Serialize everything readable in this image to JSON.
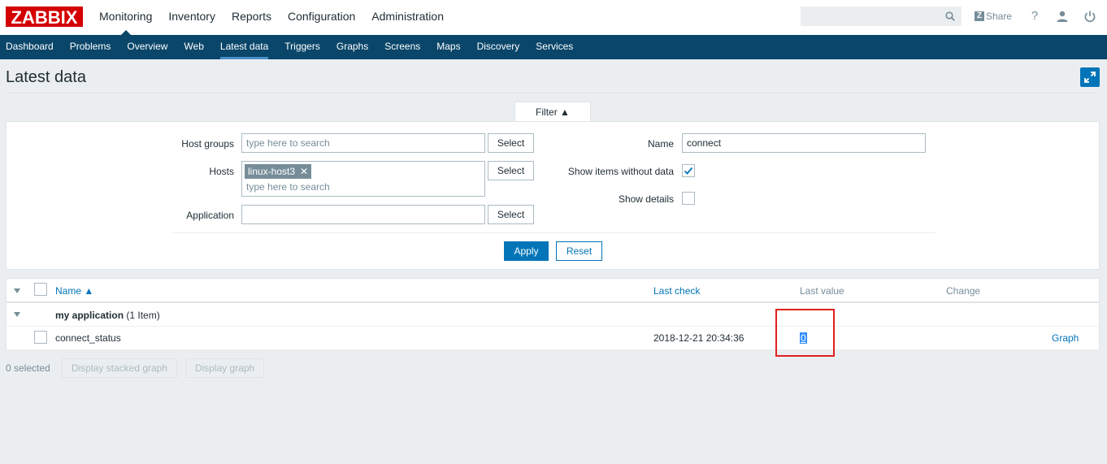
{
  "brand": {
    "logo_text": "ZABBIX",
    "color": "#d40000"
  },
  "colors": {
    "nav_bg": "#0a466a",
    "accent": "#0275b8",
    "highlight": "#e02020"
  },
  "main_nav": [
    {
      "label": "Monitoring",
      "active": true
    },
    {
      "label": "Inventory"
    },
    {
      "label": "Reports"
    },
    {
      "label": "Configuration"
    },
    {
      "label": "Administration"
    }
  ],
  "header": {
    "search_placeholder": "",
    "share_label": "Share",
    "share_icon_letter": "Z",
    "help_label": "?"
  },
  "sub_nav": [
    {
      "label": "Dashboard"
    },
    {
      "label": "Problems"
    },
    {
      "label": "Overview"
    },
    {
      "label": "Web"
    },
    {
      "label": "Latest data",
      "active": true
    },
    {
      "label": "Triggers"
    },
    {
      "label": "Graphs"
    },
    {
      "label": "Screens"
    },
    {
      "label": "Maps"
    },
    {
      "label": "Discovery"
    },
    {
      "label": "Services"
    }
  ],
  "page": {
    "title": "Latest data"
  },
  "filter": {
    "tab_label": "Filter ▲",
    "host_groups_label": "Host groups",
    "host_groups_placeholder": "type here to search",
    "hosts_label": "Hosts",
    "hosts_tag": "linux-host3",
    "hosts_placeholder": "type here to search",
    "application_label": "Application",
    "application_value": "",
    "select_label": "Select",
    "name_label": "Name",
    "name_value": "connect",
    "show_items_label": "Show items without data",
    "show_items_checked": true,
    "show_details_label": "Show details",
    "show_details_checked": false,
    "apply_label": "Apply",
    "reset_label": "Reset"
  },
  "table": {
    "columns": {
      "name": "Name ▲",
      "last_check": "Last check",
      "last_value": "Last value",
      "change": "Change"
    },
    "group": {
      "name": "my application",
      "count": "(1 Item)"
    },
    "rows": [
      {
        "name": "connect_status",
        "last_check": "2018-12-21 20:34:36",
        "last_value": "0",
        "change": "",
        "action": "Graph"
      }
    ]
  },
  "footer": {
    "selected": "0 selected",
    "stacked_graph_label": "Display stacked graph",
    "graph_label": "Display graph"
  }
}
